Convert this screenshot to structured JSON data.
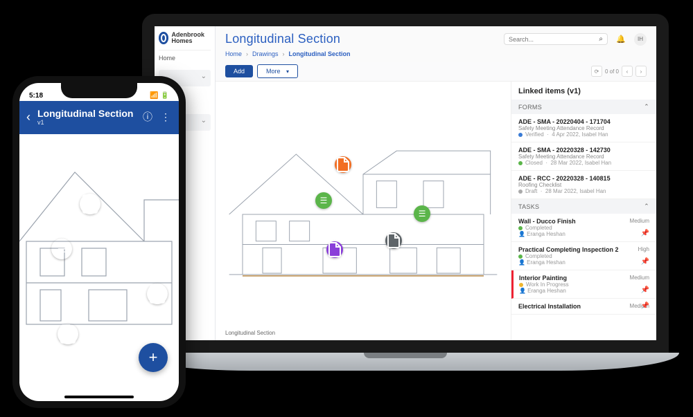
{
  "brand": {
    "name": "Adenbrook Homes"
  },
  "sidebar": {
    "home": "Home"
  },
  "header": {
    "title": "Longitudinal Section",
    "search_placeholder": "Search...",
    "avatar_initials": "IH"
  },
  "crumbs": {
    "home": "Home",
    "drawings": "Drawings",
    "current": "Longitudinal Section"
  },
  "toolbar": {
    "add": "Add",
    "more": "More",
    "pager": "0 of 0"
  },
  "canvas": {
    "caption": "Longitudinal Section"
  },
  "linked": {
    "title": "Linked items (v1)",
    "forms_label": "FORMS",
    "tasks_label": "TASKS",
    "forms": [
      {
        "title": "ADE - SMA - 20220404 - 171704",
        "sub": "Safety Meeting Attendance Record",
        "status": "Verified",
        "dot": "blue",
        "meta": "4 Apr 2022, Isabel Han"
      },
      {
        "title": "ADE - SMA - 20220328 - 142730",
        "sub": "Safety Meeting Attendance Record",
        "status": "Closed",
        "dot": "green",
        "meta": "28 Mar 2022, Isabel Han"
      },
      {
        "title": "ADE - RCC - 20220328 - 140815",
        "sub": "Roofing Checklist",
        "status": "Draft",
        "dot": "gray",
        "meta": "28 Mar 2022, Isabel Han"
      }
    ],
    "tasks": [
      {
        "title": "Wall - Ducco Finish",
        "status": "Completed",
        "dot": "green",
        "assignee": "Eranga Heshan",
        "priority": "Medium",
        "redbar": false
      },
      {
        "title": "Practical Completing Inspection 2",
        "status": "Completed",
        "dot": "green",
        "assignee": "Eranga Heshan",
        "priority": "High",
        "redbar": false
      },
      {
        "title": "Interior Painting",
        "status": "Work In Progress",
        "dot": "yellow",
        "assignee": "Eranga Heshan",
        "priority": "Medium",
        "redbar": true
      },
      {
        "title": "Electrical Installation",
        "status": "",
        "dot": "",
        "assignee": "",
        "priority": "Medium",
        "redbar": false
      }
    ]
  },
  "phone": {
    "time": "5:18",
    "title": "Longitudinal Section",
    "sub": "v1"
  }
}
